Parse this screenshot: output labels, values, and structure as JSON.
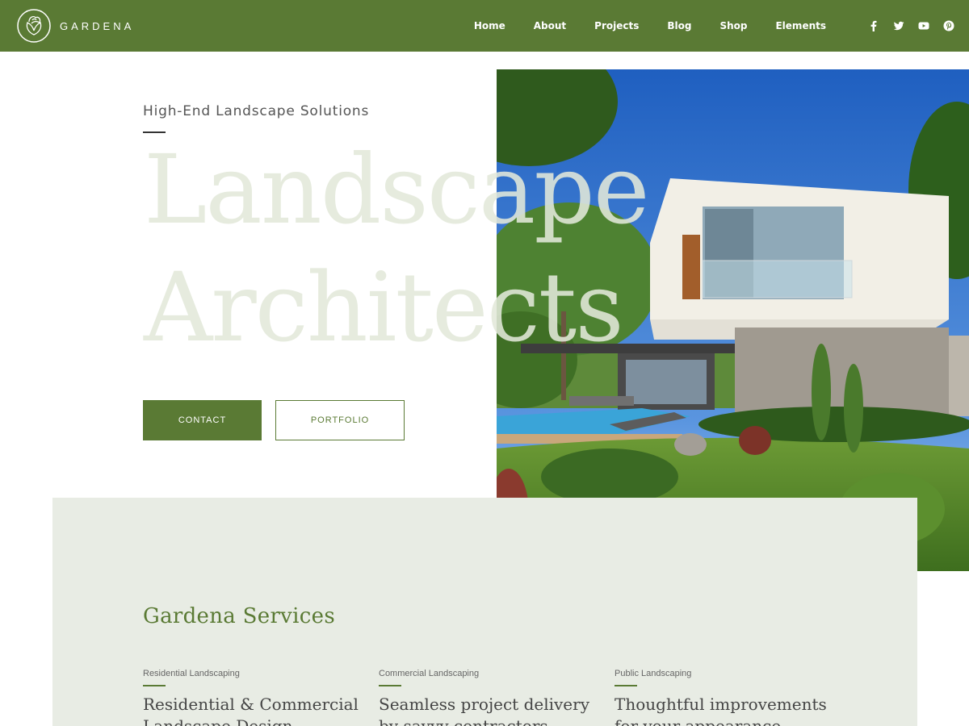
{
  "brand": {
    "name": "GARDENA",
    "logo_icon": "rose-icon",
    "accent_color": "#5a7a34",
    "panel_color": "#e8ece4"
  },
  "nav": {
    "items": [
      "Home",
      "About",
      "Projects",
      "Blog",
      "Shop",
      "Elements"
    ],
    "social": [
      "facebook-icon",
      "twitter-icon",
      "youtube-icon",
      "pinterest-icon"
    ]
  },
  "hero": {
    "subtitle": "High-End Landscape Solutions",
    "title_line1": "Landscape",
    "title_line2": "Architects",
    "contact_label": "CONTACT",
    "portfolio_label": "PORTFOLIO"
  },
  "services": {
    "title": "Gardena Services",
    "items": [
      {
        "tag": "Residential Landscaping",
        "heading": "Residential & Commercial Landscape Design"
      },
      {
        "tag": "Commercial Landscaping",
        "heading": "Seamless project delivery by savvy contractors"
      },
      {
        "tag": "Public Landscaping",
        "heading": "Thoughtful improvements for your appearance"
      }
    ]
  }
}
